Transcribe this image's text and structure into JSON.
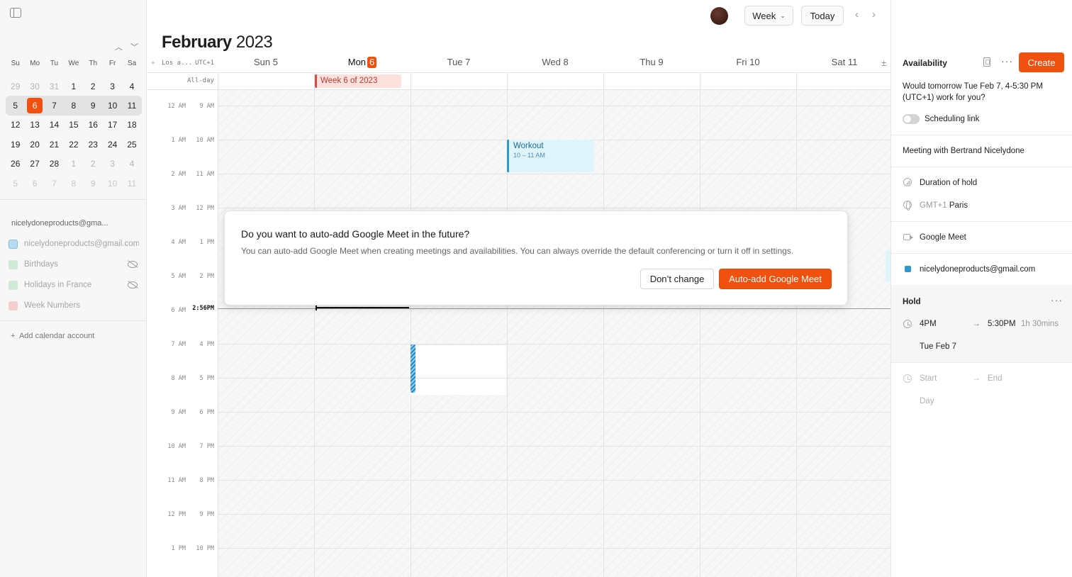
{
  "sidebar": {
    "mini_calendar": {
      "weekdays": [
        "Su",
        "Mo",
        "Tu",
        "We",
        "Th",
        "Fr",
        "Sa"
      ],
      "weeks": [
        [
          "29",
          "30",
          "31",
          "1",
          "2",
          "3",
          "4"
        ],
        [
          "5",
          "6",
          "7",
          "8",
          "9",
          "10",
          "11"
        ],
        [
          "12",
          "13",
          "14",
          "15",
          "16",
          "17",
          "18"
        ],
        [
          "19",
          "20",
          "21",
          "22",
          "23",
          "24",
          "25"
        ],
        [
          "26",
          "27",
          "28",
          "1",
          "2",
          "3",
          "4"
        ],
        [
          "5",
          "6",
          "7",
          "8",
          "9",
          "10",
          "11"
        ]
      ],
      "today": "6"
    },
    "account_title": "nicelydoneproducts@gma...",
    "calendars": [
      {
        "label": "nicelydoneproducts@gmail.com",
        "color": "#b7dbef"
      },
      {
        "label": "Birthdays",
        "color": "#cdebd5"
      },
      {
        "label": "Holidays in France",
        "color": "#cdebd5"
      },
      {
        "label": "Week Numbers",
        "color": "#f6cfcc"
      }
    ],
    "add_account_label": "Add calendar account"
  },
  "header": {
    "view_label": "Week",
    "today_label": "Today",
    "month": "February",
    "year": "2023"
  },
  "week": {
    "timezone_primary": "Los a...",
    "timezone_secondary": "UTC+1",
    "days": [
      {
        "name": "Sun",
        "num": "5"
      },
      {
        "name": "Mon",
        "num": "6"
      },
      {
        "name": "Tue",
        "num": "7"
      },
      {
        "name": "Wed",
        "num": "8"
      },
      {
        "name": "Thu",
        "num": "9"
      },
      {
        "name": "Fri",
        "num": "10"
      },
      {
        "name": "Sat",
        "num": "11"
      }
    ],
    "allday_label": "All-day",
    "week_chip": "Week 6 of 2023",
    "times_primary": [
      "12 AM",
      "1 AM",
      "2 AM",
      "3 AM",
      "4 AM",
      "5 AM",
      "6 AM",
      "7 AM",
      "8 AM",
      "9 AM",
      "10 AM",
      "11 AM",
      "12 PM",
      "1 PM"
    ],
    "times_secondary": [
      "9 AM",
      "10 AM",
      "11 AM",
      "12 PM",
      "1 PM",
      "2 PM",
      "",
      "4 PM",
      "5 PM",
      "6 PM",
      "7 PM",
      "8 PM",
      "9 PM",
      "10 PM"
    ],
    "now_label": "2:56PM",
    "event_workout": {
      "title": "Workout",
      "time": "10 – 11 AM"
    }
  },
  "dialog": {
    "title": "Do you want to auto-add Google Meet in the future?",
    "body": "You can auto-add Google Meet when creating meetings and availabilities. You can always override the default conferencing or turn it off in settings.",
    "secondary_label": "Don’t change",
    "primary_label": "Auto-add Google Meet"
  },
  "panel": {
    "title": "Availability",
    "create_label": "Create",
    "message": "Would tomorrow Tue Feb 7, 4-5:30 PM (UTC+1) work for you?",
    "scheduling_link_label": "Scheduling link",
    "meeting_title": "Meeting with Bertrand Nicelydone",
    "duration_label": "Duration of hold",
    "tz_prefix": "GMT+1",
    "tz_city": "Paris",
    "conferencing": "Google Meet",
    "calendar": "nicelydoneproducts@gmail.com",
    "hold_title": "Hold",
    "hold_start": "4PM",
    "hold_end": "5:30PM",
    "hold_duration": "1h 30mins",
    "hold_date": "Tue Feb 7",
    "start_placeholder": "Start",
    "end_placeholder": "End",
    "day_placeholder": "Day",
    "colors": {
      "accent": "#f0510e",
      "event_blue": "#2d99cf"
    }
  }
}
